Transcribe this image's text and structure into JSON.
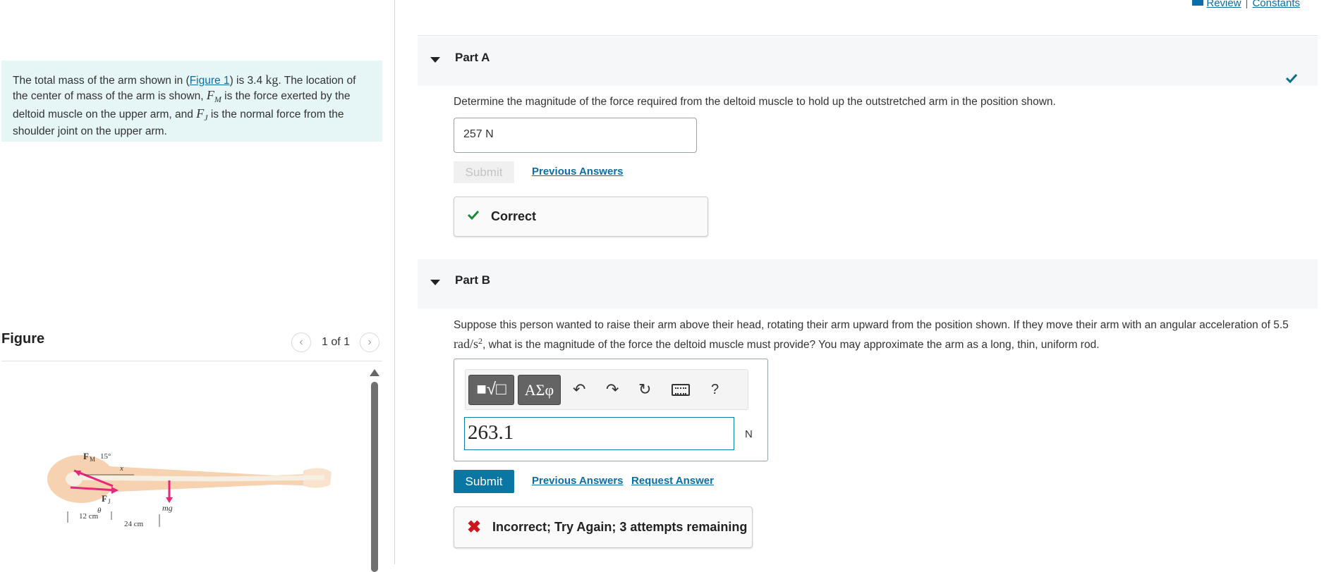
{
  "top_links": {
    "review": "Review",
    "separator": "|",
    "constants": "Constants"
  },
  "intro": {
    "text_1": "The total mass of the arm shown in (",
    "figure_link": "Figure 1",
    "text_2": ") is 3.4 ",
    "mass_unit": "kg",
    "text_3": ". The location of the center of mass of the arm is shown, ",
    "fm_symbol": "F",
    "fm_sub": "M",
    "text_4": " is the force exerted by the deltoid muscle on the upper arm, and ",
    "fj_symbol": "F",
    "fj_sub": "J",
    "text_5": " is the normal force from the shoulder joint on the upper arm."
  },
  "figure_panel": {
    "title": "Figure",
    "counter": "1 of 1",
    "prev_icon": "chevron-left-icon",
    "next_icon": "chevron-right-icon",
    "labels": {
      "fm": "F",
      "fm_sub": "M",
      "angle": "15°",
      "x": "x",
      "fj": "F",
      "fj_sub": "J",
      "theta": "θ",
      "mg": "mg",
      "d1": "12 cm",
      "d2": "24 cm"
    }
  },
  "part_a": {
    "title": "Part A",
    "question": "Determine the magnitude of the force required from the deltoid muscle to hold up the outstretched arm in the position shown.",
    "answer": "257  N",
    "submit_label": "Submit",
    "previous_answers": "Previous Answers",
    "feedback": "Correct",
    "status_icon": "checkmark-icon"
  },
  "part_b": {
    "title": "Part B",
    "question_1": "Suppose this person wanted to raise their arm above their head, rotating their arm upward from the position shown.  If they move their arm with an angular acceleration of 5.5 ",
    "accel_unit": "rad/s",
    "accel_exp": "2",
    "question_2": ", what is the magnitude of the force the deltoid muscle must provide?  You may approximate the arm as a long, thin, uniform rod.",
    "toolbar": {
      "templates_icon": "templates-icon",
      "greek": "ΑΣφ",
      "undo_icon": "undo-icon",
      "redo_icon": "redo-icon",
      "reset_icon": "reset-icon",
      "keyboard_icon": "keyboard-icon",
      "help": "?"
    },
    "answer_value": "263.1",
    "unit": "N",
    "submit_label": "Submit",
    "previous_answers": "Previous Answers",
    "request_answer": "Request Answer",
    "feedback": "Incorrect; Try Again; 3 attempts remaining",
    "feedback_icon": "x-icon"
  },
  "colors": {
    "accent": "#0a76a3",
    "intro_bg": "#e6f5f5",
    "correct": "#1a8a3a",
    "incorrect": "#d0161a",
    "force_arrow": "#e8267a"
  }
}
